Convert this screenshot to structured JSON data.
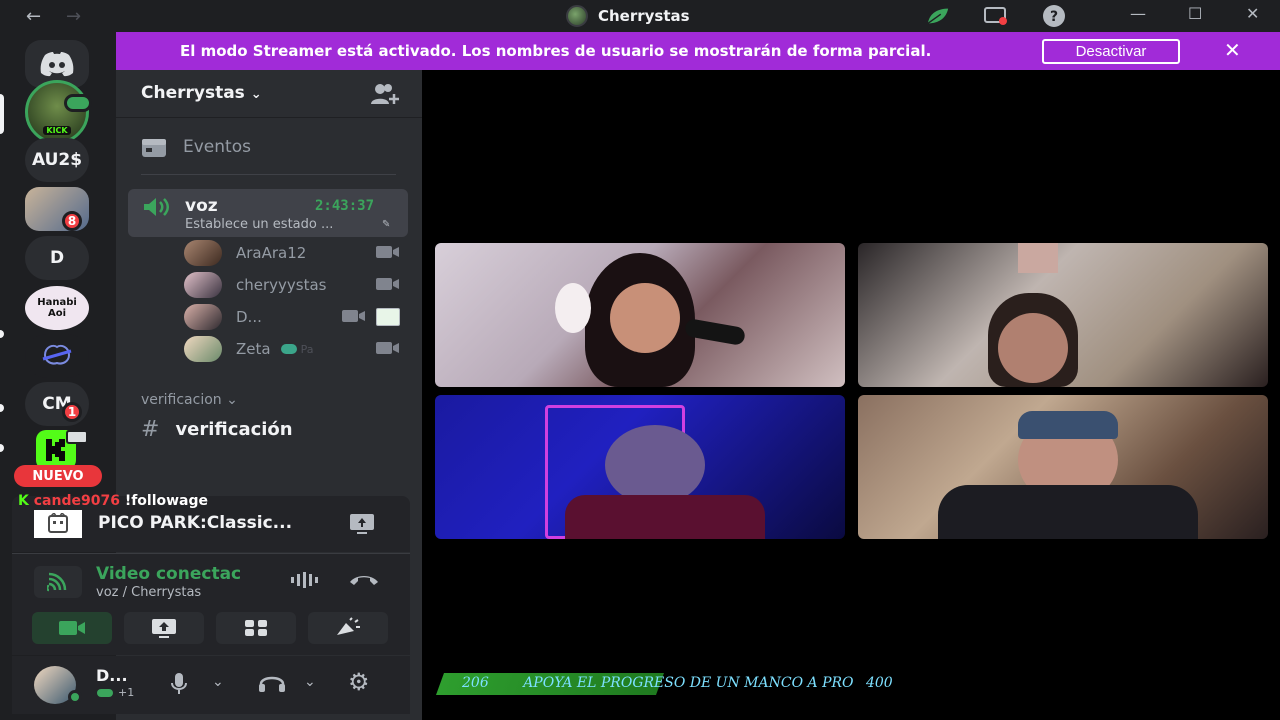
{
  "titlebar": {
    "back_icon": "arrow-left-icon",
    "forward_icon": "arrow-right-icon",
    "title": "Cherrystas",
    "icons": [
      "nitro-leaf-icon",
      "screen-share-icon",
      "help-icon"
    ],
    "window_controls": [
      "minimize-icon",
      "maximize-icon",
      "close-icon"
    ]
  },
  "servers": [
    {
      "label": "",
      "name": "kick-server",
      "active": true
    },
    {
      "label": "AU2$",
      "name": "au2-server"
    },
    {
      "label": "",
      "name": "cap-user-server",
      "badge": "8"
    },
    {
      "label": "D",
      "name": "d-server"
    },
    {
      "label": "Hanabi Aoi",
      "name": "hanabi-server"
    },
    {
      "label": "",
      "name": "brain-server"
    },
    {
      "label": "CM",
      "name": "cm-server",
      "badge": "1"
    },
    {
      "label": "",
      "name": "kick-green-server"
    }
  ],
  "banner": {
    "text": "El modo Streamer está activado. Los nombres de usuario se mostrarán de forma parcial.",
    "button": "Desactivar"
  },
  "sidebar": {
    "guild_name": "Cherrystas",
    "events_label": "Eventos",
    "voice_channel": {
      "name": "voz",
      "timer": "2:43:37",
      "status": "Establece un estado ..."
    },
    "voice_users": [
      {
        "name": "AraAra12",
        "extra": ""
      },
      {
        "name": "cheryyystas",
        "extra": ""
      },
      {
        "name": "D...",
        "extra": ""
      },
      {
        "name": "Zeta",
        "extra": "Pa"
      }
    ],
    "category": "verificacion",
    "text_channel": "verificación"
  },
  "activity": {
    "name": "PICO PARK:Classic..."
  },
  "rtc": {
    "status": "Video conectac",
    "subtitle": "voz / Cherrystas"
  },
  "user": {
    "name": "D...",
    "activity_count": "+1"
  },
  "overlay": {
    "new_badge": "NUEVO",
    "chat_user": "cande9076",
    "chat_message": "!followage",
    "ticker_start": "206",
    "ticker_text": "APOYA EL PROGRESO DE UN MANCO A PRO",
    "ticker_end": "400"
  },
  "colors": {
    "banner": "#a12bd8",
    "connected_green": "#3ba55c",
    "ticker_text": "#7de0ff",
    "new_badge": "#e8363b"
  }
}
